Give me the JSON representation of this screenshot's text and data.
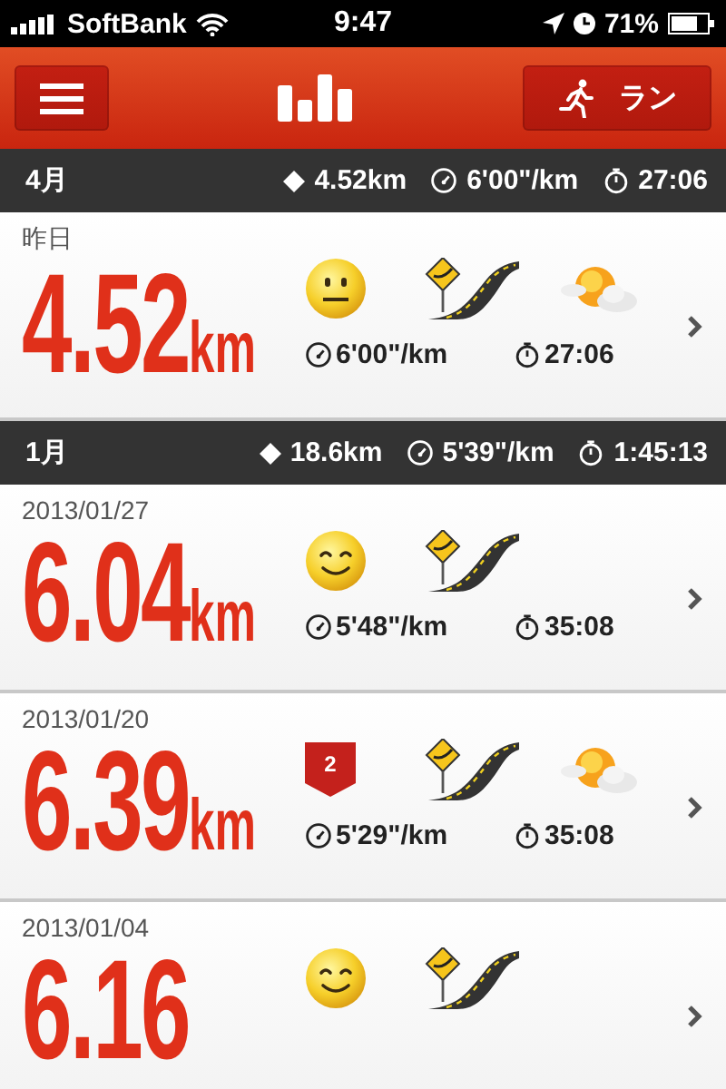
{
  "status_bar": {
    "carrier": "SoftBank",
    "time": "9:47",
    "battery": "71%"
  },
  "nav": {
    "run_button": "ラン"
  },
  "sections": [
    {
      "month": "4月",
      "distance": "4.52km",
      "pace": "6'00\"/km",
      "duration": "27:06",
      "runs": [
        {
          "date": "昨日",
          "distance": "4.52",
          "unit": "km",
          "icons": [
            {
              "kind": "neutral"
            },
            {
              "kind": "road"
            },
            {
              "kind": "weather"
            }
          ],
          "pace": "6'00\"/km",
          "duration": "27:06"
        }
      ]
    },
    {
      "month": "1月",
      "distance": "18.6km",
      "pace": "5'39\"/km",
      "duration": "1:45:13",
      "runs": [
        {
          "date": "2013/01/27",
          "distance": "6.04",
          "unit": "km",
          "icons": [
            {
              "kind": "smile"
            },
            {
              "kind": "road"
            }
          ],
          "pace": "5'48\"/km",
          "duration": "35:08"
        },
        {
          "date": "2013/01/20",
          "distance": "6.39",
          "unit": "km",
          "icons": [
            {
              "kind": "badge",
              "text": "2"
            },
            {
              "kind": "road"
            },
            {
              "kind": "weather"
            }
          ],
          "pace": "5'29\"/km",
          "duration": "35:08"
        },
        {
          "date": "2013/01/04",
          "distance": "6.16",
          "icons": [
            {
              "kind": "smile"
            },
            {
              "kind": "road"
            }
          ]
        }
      ]
    }
  ]
}
